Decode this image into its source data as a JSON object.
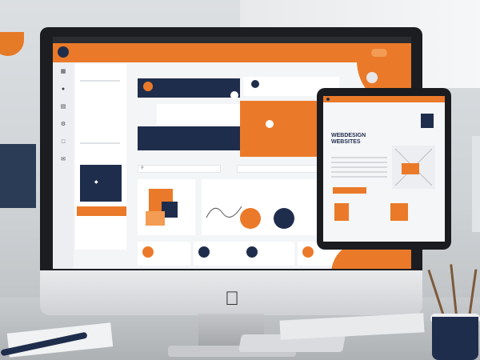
{
  "colors": {
    "accent_orange": "#ea7a29",
    "navy": "#1f2d4d",
    "screen_bg": "#f4f5f7"
  },
  "icons": [
    "apple-logo-icon",
    "search-icon",
    "grid-icon",
    "user-icon"
  ],
  "monitor": {
    "brand_icon": "",
    "topbar_text": "",
    "header_nav": [
      "",
      "",
      "",
      ""
    ],
    "header_button": "",
    "sidebar": {
      "items": [
        "",
        "",
        "",
        "",
        ""
      ],
      "card_label": "",
      "button": ""
    },
    "main": {
      "section_title": "",
      "hero_text": "",
      "mid_text_1": "",
      "mid_text_2": "",
      "navy_text": "",
      "top_card_text": "",
      "top_card_text_2": "",
      "right_label": "",
      "orange_panel_title": "",
      "orange_panel_sub": "",
      "row_label_1": "",
      "row_label_2": "",
      "search_1": "",
      "search_2": "",
      "chart_title": "",
      "chart_sub": "",
      "bottom_cards": [
        "",
        "",
        "",
        ""
      ]
    }
  },
  "tablet": {
    "title_line_1": "WEBDESIGN",
    "title_line_2": "WEBSITES",
    "subtitle": "",
    "button": "",
    "caption": "",
    "card_1": "",
    "card_2": ""
  }
}
